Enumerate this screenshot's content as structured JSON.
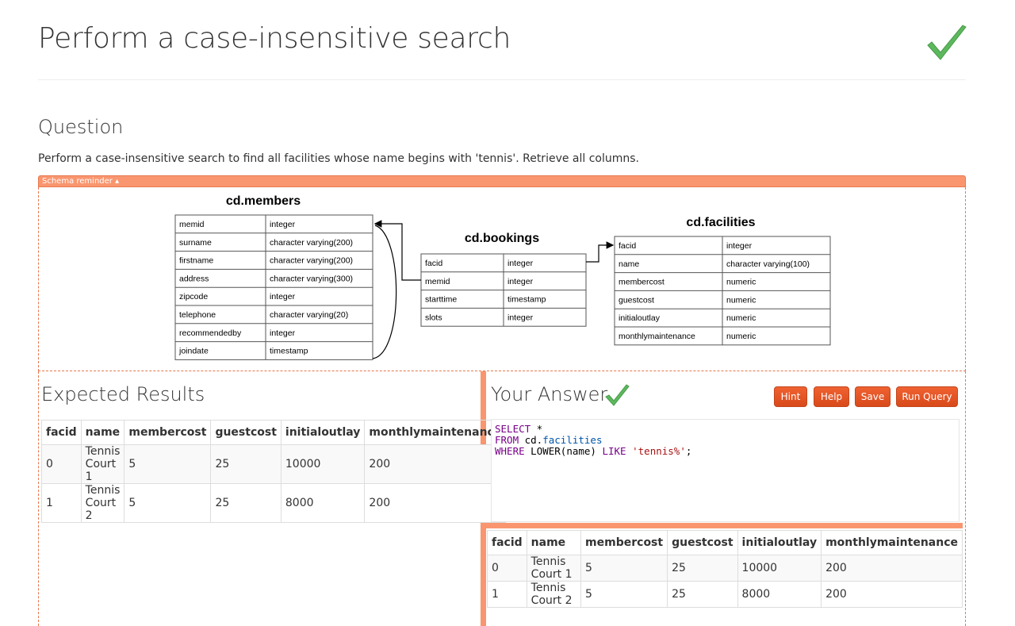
{
  "page": {
    "title": "Perform a case-insensitive search"
  },
  "question": {
    "heading": "Question",
    "text": "Perform a case-insensitive search to find all facilities whose name begins with 'tennis'. Retrieve all columns."
  },
  "schema": {
    "toggle_label": "Schema reminder ▴",
    "tables": [
      {
        "name": "cd.members",
        "columns": [
          [
            "memid",
            "integer"
          ],
          [
            "surname",
            "character varying(200)"
          ],
          [
            "firstname",
            "character varying(200)"
          ],
          [
            "address",
            "character varying(300)"
          ],
          [
            "zipcode",
            "integer"
          ],
          [
            "telephone",
            "character varying(20)"
          ],
          [
            "recommendedby",
            "integer"
          ],
          [
            "joindate",
            "timestamp"
          ]
        ]
      },
      {
        "name": "cd.bookings",
        "columns": [
          [
            "facid",
            "integer"
          ],
          [
            "memid",
            "integer"
          ],
          [
            "starttime",
            "timestamp"
          ],
          [
            "slots",
            "integer"
          ]
        ]
      },
      {
        "name": "cd.facilities",
        "columns": [
          [
            "facid",
            "integer"
          ],
          [
            "name",
            "character varying(100)"
          ],
          [
            "membercost",
            "numeric"
          ],
          [
            "guestcost",
            "numeric"
          ],
          [
            "initialoutlay",
            "numeric"
          ],
          [
            "monthlymaintenance",
            "numeric"
          ]
        ]
      }
    ]
  },
  "expected": {
    "heading": "Expected Results",
    "columns": [
      "facid",
      "name",
      "membercost",
      "guestcost",
      "initialoutlay",
      "monthlymaintenance"
    ],
    "rows": [
      [
        "0",
        "Tennis Court 1",
        "5",
        "25",
        "10000",
        "200"
      ],
      [
        "1",
        "Tennis Court 2",
        "5",
        "25",
        "8000",
        "200"
      ]
    ]
  },
  "answer": {
    "heading": "Your Answer",
    "buttons": {
      "hint": "Hint",
      "help": "Help",
      "save": "Save",
      "run": "Run Query"
    },
    "query": {
      "line1_kw": "SELECT",
      "line1_rest": " *",
      "line2_kw": "FROM",
      "line2_schema": " cd.",
      "line2_table": "facilities",
      "line3_kw": "WHERE",
      "line3_fn": " LOWER(name) ",
      "line3_like": "LIKE",
      "line3_str": " 'tennis%'",
      "line3_end": ";"
    },
    "columns": [
      "facid",
      "name",
      "membercost",
      "guestcost",
      "initialoutlay",
      "monthlymaintenance"
    ],
    "rows": [
      [
        "0",
        "Tennis Court 1",
        "5",
        "25",
        "10000",
        "200"
      ],
      [
        "1",
        "Tennis Court 2",
        "5",
        "25",
        "8000",
        "200"
      ]
    ]
  },
  "colors": {
    "accent": "#f9966f",
    "button": "#e4572a",
    "check": "#5cb85c"
  },
  "icons": {
    "title_status": "checkmark-icon",
    "answer_status": "checkmark-icon"
  }
}
